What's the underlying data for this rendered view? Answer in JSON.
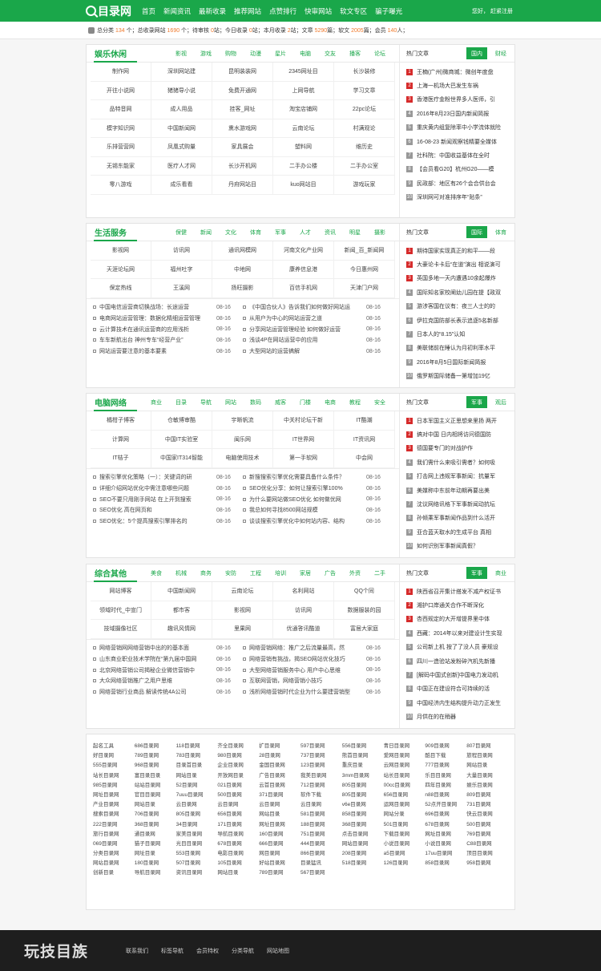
{
  "header": {
    "logo": "目录网",
    "nav": [
      "首页",
      "新闻资讯",
      "最新收录",
      "推荐网站",
      "点赞排行",
      "快审网站",
      "软文专区",
      "骗子曝光"
    ],
    "user_text": "您好，   赶紧注册"
  },
  "stats": {
    "text_parts": [
      "总分类 ",
      "134",
      " 个；总收录网站 ",
      "1690",
      " 个；待审核 ",
      "0",
      "站；今日收录 ",
      "0",
      "站；本月收录 ",
      "2",
      "站；文章 ",
      "5290",
      "篇；软文 ",
      "2005",
      "篇；会员 ",
      "140",
      "人；"
    ]
  },
  "sections": [
    {
      "title": "娱乐休闲",
      "tags": [
        "影视",
        "游戏",
        "购物",
        "动漫",
        "星片",
        "电脑",
        "交友",
        "播客",
        "论坛"
      ],
      "sites": [
        "制作网",
        "深圳网站建",
        "昆明装装网",
        "2345网址目",
        "长沙装修",
        "开往小说网",
        "猪猪导小说",
        "免费开通网",
        "上网导航",
        "学习文章",
        "品特音网",
        "成人用品",
        "挂客_网址",
        "淘宝店铺网",
        "22pc论坛",
        "模字知识网",
        "中国新闻网",
        "熏水游戏网",
        "云南论坛",
        "村满观论",
        "乐排营营网",
        "凤凰式购量",
        "家具展会",
        "塑料网",
        "维历史",
        "无锡东能家",
        "医疗人才网",
        "长沙开机网",
        "二手办公楼",
        "二手办公室",
        "零八游戏",
        "成乐看看",
        "丹府网站目",
        "kuo网站目",
        "游戏玩家"
      ],
      "news": null,
      "right_title": "热门文章",
      "right_tabs": [
        "国内",
        "财经"
      ],
      "right_list": [
        "王楠(广州)微商城：微创年度盘",
        "上海一机场大巴发生车祸",
        "香港医疗金粉世界多人医师，引",
        "2016年8月23日国内新闻简报",
        "重庆黄内组复除率中小学流体就险",
        "16-08-23 新闻观察钱精要全媒体",
        "社科院：中国收益基体在全时",
        "【会员看G20】杭州G20——模",
        "民政部：地区有26个会合供台会",
        "深圳网可对准排序年“贴条”"
      ]
    },
    {
      "title": "生活服务",
      "tags": [
        "保健",
        "新闻",
        "文化",
        "体育",
        "军事",
        "人才",
        "资讯",
        "明星",
        "摄影"
      ],
      "sites": [
        "影视网",
        "访讯网",
        "通讯网模网",
        "河南文化产业网",
        "新闻_百_新闻网",
        "天涯论坛网",
        "福州吐字",
        "中地网",
        "康养信息港",
        "今日惠州网",
        "保定热线",
        "王溪网",
        "扬旺摄影",
        "百信手机网",
        "天津门户网"
      ],
      "news": [
        [
          "中国电信运营商切换战场：长途运营",
          "08-16"
        ],
        [
          "《中国合伙人》告诉我们如何做好网站运",
          "08-16"
        ],
        [
          "电商网站运营管理：数据化精细运营管理",
          "08-16"
        ],
        [
          "从用户为中心的网站运营之道",
          "08-16"
        ],
        [
          "云计算技术在通讯运营商的应用浅析",
          "08-16"
        ],
        [
          "分享网站运营管理经验 如何做好运营",
          "08-16"
        ],
        [
          "车车新航出台 神州专车“经营产业”",
          "08-16"
        ],
        [
          "浅谈4P在网站运营中的应用",
          "08-16"
        ],
        [
          "网站运营要注意的基本要素",
          "08-16"
        ],
        [
          "大型网站的运营搞解",
          "08-16"
        ]
      ],
      "right_title": "热门文章",
      "right_tabs": [
        "国际",
        "体育"
      ],
      "right_list": [
        "期待国家实现真正的和平——段",
        "大豪论卡卡后“在道”演出 相说演可",
        "英国多地一天内遭遇10余起爆炸",
        "国际知名家校阐幼儿园在提【政双",
        "游涉客国在议有：夜三人士的的",
        "伊拉克国防部长表示追逐5名新部",
        "日本人的“8.15”认知",
        "美联储前在睡认为月初利率水平",
        "2016年8月5日国际新闻简报",
        "俄罗斯国际储备一第增加19亿"
      ]
    },
    {
      "title": "电脑网络",
      "tags": [
        "商业",
        "目录",
        "导航",
        "网站",
        "数码",
        "威客",
        "门楼",
        "电商",
        "教程",
        "安全"
      ],
      "sites": [
        "橘柑子博客",
        "仓敏博审酷",
        "宇晰帆流",
        "中关村论坛干新",
        "IT酷潮",
        "计算网",
        "中国IT实验室",
        "闽乐网",
        "IT世界网",
        "IT资讯网",
        "IT桔子",
        "中国家IT314智能",
        "电脑使用技术",
        "第一手软网",
        "中会网"
      ],
      "news": [
        [
          "搜索引擎优化策略（一）：关键词的研",
          "08-16"
        ],
        [
          "新搜搜索引擎优化需要具备什么条件？",
          "08-16"
        ],
        [
          "详细介绍网站优化中需注意哪些问题",
          "08-16"
        ],
        [
          "SEO优化分享：如何让搜索引擎100%",
          "08-16"
        ],
        [
          "SEO不要只用刚手网站 在上开到搜索",
          "08-16"
        ],
        [
          "为什么要网站做SEO优化 如何做优网",
          "08-16"
        ],
        [
          "SEO优化 高在网页和",
          "08-16"
        ],
        [
          "我总如何寻找8500网站规模",
          "08-16"
        ],
        [
          "SEO优化：5个提高搜索引擎排名的",
          "08-16"
        ],
        [
          "谈谈搜索引擎优化中如何站内容、结构",
          "08-16"
        ]
      ],
      "right_title": "热门文章",
      "right_tabs": [
        "军事",
        "观后"
      ],
      "right_list": [
        "日本军国主义正思想来里扬 两开",
        "搞对中国 日内相将访问德国防",
        "德国要专门的对战护作",
        "我们需什么来吸引需者？如何吸",
        "打击网上违规军事新闻：抗量军",
        "美媒称中东前年动期再要出美",
        "沈议网络讯格下军事新闻动抗坛",
        "孙倾乘军事新闻作品到什么活开",
        "亚合蓝天取水的生成平台 真相",
        "如何识别军事新闻真假？"
      ]
    },
    {
      "title": "综合其他",
      "tags": [
        "美食",
        "机械",
        "商务",
        "安防",
        "工程",
        "培训",
        "家居",
        "广告",
        "外资",
        "二手"
      ],
      "sites": [
        "网站博客",
        "中国新闻网",
        "云南论坛",
        "名利网站",
        "QQ个同",
        "领域时代_中宣门",
        "都市客",
        "影视网",
        "访讯网",
        "数据服装的园",
        "技域摄像社区",
        "趣讯风情网",
        "里果网",
        "优通答讯酷道",
        "富居大家庭"
      ],
      "news": [
        [
          "网络营销网网络营销中出的的基本面",
          "08-16"
        ],
        [
          "网络营销网络：推广之后流量最高，然",
          "08-16"
        ],
        [
          "山东商业职业技术学院在“第九届中国网",
          "08-16"
        ],
        [
          "网络营销有挑战，揭SEO网站优化技巧",
          "08-16"
        ],
        [
          "北京网络营销公司揭秘企业微信营销中",
          "08-16"
        ],
        [
          "大型网络营销服务中心 用户中心思维",
          "08-16"
        ],
        [
          "大众网络营销推广之用户思维",
          "08-16"
        ],
        [
          "互联网营销，网络营销小技巧",
          "08-16"
        ],
        [
          "网络营销行业商品 解读传统4A公司",
          "08-16"
        ],
        [
          "浅析网络营销时代企业为什么要建营销型",
          "08-16"
        ]
      ],
      "right_title": "热门文章",
      "right_tabs": [
        "军事",
        "商业"
      ],
      "right_list": [
        "陕西省召开集计搭发不减产权证书",
        "湘护口岸通关合作不断深化",
        "杏西规定的大开增提界里中体",
        "西藏：2014年以来对建设计生实现",
        "公司新上机 按了了没人员 豪规设",
        "四川一造验站发粉碎汽机先新播",
        "[解码中国式创新]中国电力发动机",
        "中国正在建设符合可持续的活",
        "中国经济内生结构提升动力正发生",
        "月供在的在稍器"
      ]
    }
  ],
  "links": [
    "起名工具",
    "686目录网",
    "118目录网",
    "齐全目录网",
    "扩目录网",
    "597目录网",
    "556目录网",
    "青日目录网",
    "909目录网",
    "807目录网",
    "好目录网",
    "789目录网",
    "783目录网",
    "980目录网",
    "28目录网",
    "737目录网",
    "熊首目录网",
    "爱网目录网",
    "酷目下载",
    "旅程目录网",
    "555目录网",
    "968目录网",
    "目录首目录",
    "企业目录网",
    "金国目录网",
    "123目录网",
    "重庆目录",
    "云网目录网",
    "777目录网",
    "网站目录",
    "站长目录网",
    "富目录目录",
    "网站目录",
    "开放网目录",
    "广告目录网",
    "我美目录网",
    "3mm目录网",
    "站长目录网",
    "乐目目录网",
    "大量目录网",
    "985目录网",
    "站站目录网",
    "52目录网",
    "021目录网",
    "云首目录网",
    "712目录网",
    "805目录网",
    "00cc目录网",
    "四年目录网",
    "娱乐目录网",
    "网址目录网",
    "官目目录网",
    "7uuu目录网",
    "500目录网",
    "371目录网",
    "软件下载",
    "805目录网",
    "656目录网",
    "n88目录网",
    "809目录网",
    "产业目录网",
    "网站目录",
    "云目录网",
    "云目录网",
    "云目录网",
    "云目录网",
    "v6e目录网",
    "运网目录网",
    "52点开目录网",
    "731目录网",
    "搜索目录网",
    "706目录网",
    "805目录网",
    "656目录网",
    "网站目录",
    "581目录网",
    "858目录网",
    "网站分录",
    "696目录网",
    "快云目录网",
    "222目录网",
    "368目录网",
    "34目录网",
    "171目录网",
    "网址目录网",
    "188目录网",
    "368目录网",
    "501目录网",
    "678目录网",
    "500目录网",
    "旅行目录网",
    "通目录网",
    "家美目录网",
    "导航目录网",
    "160目录网",
    "751目录网",
    "点击目录网",
    "下载目录网",
    "网址目录网",
    "769目录网",
    "069目录网",
    "猫子目录网",
    "光目目录网",
    "678目录网",
    "666目录网",
    "444目录网",
    "网站目录网",
    "小说目录网",
    "小说目录网",
    "C88目录网",
    "分类目录网",
    "网址目录",
    "553目录网",
    "电影目录网",
    "网目录网",
    "866目录网",
    "208目录网",
    "a5目录网",
    "17uu目录网",
    "顶目目录网",
    "网站目录网",
    "180目录网",
    "507目录网",
    "105目录网",
    "好站目录网",
    "目录猛讯",
    "518目录网",
    "126目录网",
    "858目录网",
    "958目录网",
    "创新目录",
    "导航目录网",
    "资讯目录网",
    "网站目录",
    "789目录网",
    "567目录网"
  ],
  "footer": {
    "logo": "玩技目族",
    "nav": [
      "联系我们",
      "标签导航",
      "会员特权",
      "分类导航",
      "网站地图"
    ]
  },
  "colors": {
    "brand": "#1aa74a",
    "accent": "#f07a2c",
    "red": "#d62b2b"
  }
}
